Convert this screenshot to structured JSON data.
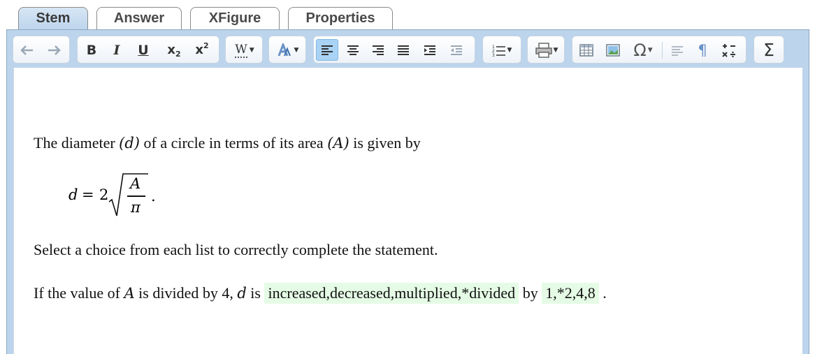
{
  "tabs": [
    {
      "label": "Stem",
      "active": true
    },
    {
      "label": "Answer",
      "active": false
    },
    {
      "label": "XFigure",
      "active": false
    },
    {
      "label": "Properties",
      "active": false
    }
  ],
  "toolbar": {
    "bold": "B",
    "italic": "I",
    "underline": "U",
    "subscript": "x",
    "subscript_sub": "2",
    "superscript": "x",
    "superscript_sup": "2",
    "word": "W",
    "sigma": "Σ",
    "omega": "Ω",
    "pilcrow": "¶"
  },
  "content": {
    "line1": {
      "before_d": "The diameter ",
      "d_var": "(d)",
      "middle": " of a circle in terms of its area ",
      "a_var": "(A)",
      "after": " is given by"
    },
    "formula": {
      "lhs": "d",
      "eq": "=",
      "coef": "2",
      "numerator": "A",
      "denominator": "π",
      "end": "."
    },
    "line2": "Select a choice from each list to correctly complete the statement.",
    "line3": {
      "part1": "If the value of ",
      "a_var": "A",
      "part2": " is divided by 4, ",
      "d_var": "d",
      "part3": " is ",
      "dropdown1": "increased,decreased,multiplied,*divided",
      "part4": " by ",
      "dropdown2": "1,*2,4,8",
      "end": " ."
    }
  }
}
